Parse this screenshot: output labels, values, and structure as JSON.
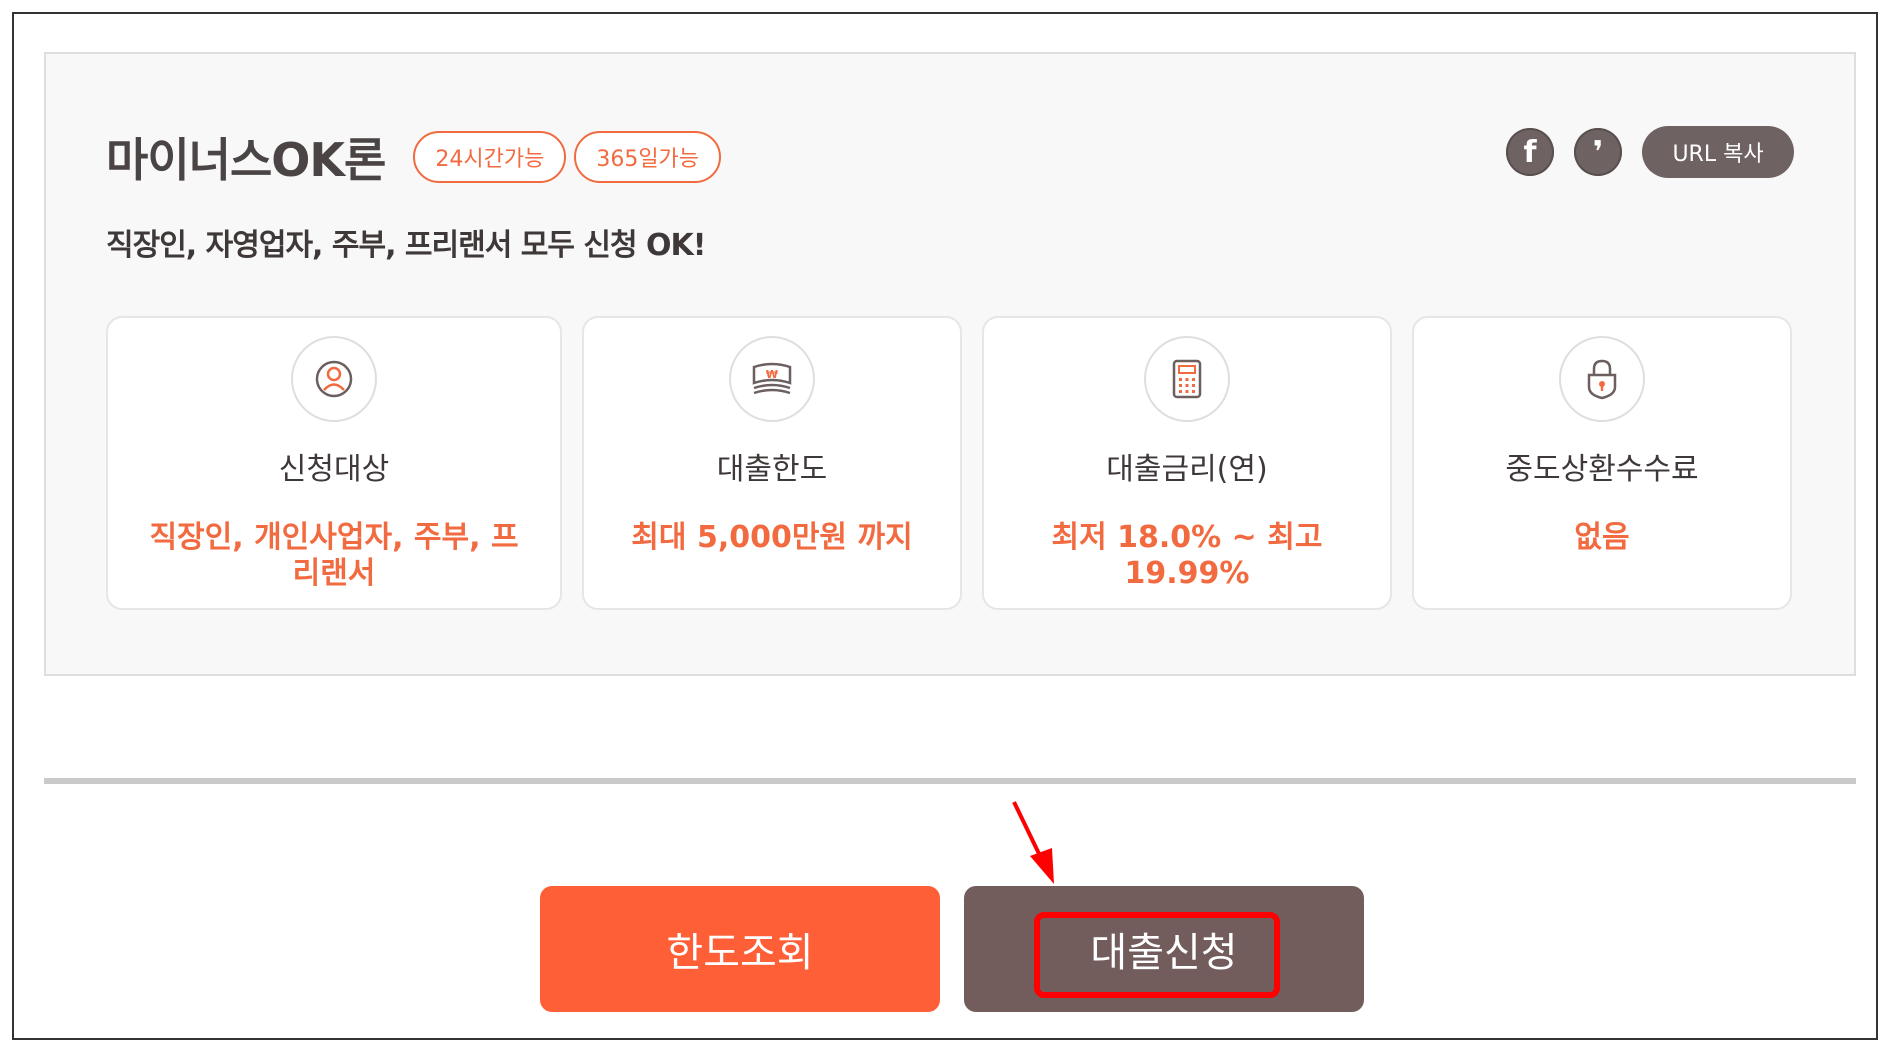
{
  "product": {
    "title": "마이너스OK론",
    "badges": [
      "24시간가능",
      "365일가능"
    ],
    "subtitle": "직장인, 자영업자, 주부, 프리랜서 모두 신청 OK!"
  },
  "share": {
    "facebook_glyph": "f",
    "kakao_glyph": "❜",
    "url_copy_label": "URL 복사"
  },
  "info_cards": [
    {
      "icon": "person-icon",
      "label": "신청대상",
      "value": "직장인, 개인사업자, 주부, 프리랜서"
    },
    {
      "icon": "won-money-icon",
      "label": "대출한도",
      "value": "최대 5,000만원 까지"
    },
    {
      "icon": "calculator-icon",
      "label": "대출금리(연)",
      "value": "최저 18.0% ~ 최고 19.99%"
    },
    {
      "icon": "lock-icon",
      "label": "중도상환수수료",
      "value": "없음"
    }
  ],
  "actions": {
    "limit_check_label": "한도조회",
    "apply_label": "대출신청"
  },
  "colors": {
    "accent": "#f26a3f",
    "primary_button": "#ff5f37",
    "secondary_button": "#735c5c",
    "highlight": "#ff0000"
  }
}
